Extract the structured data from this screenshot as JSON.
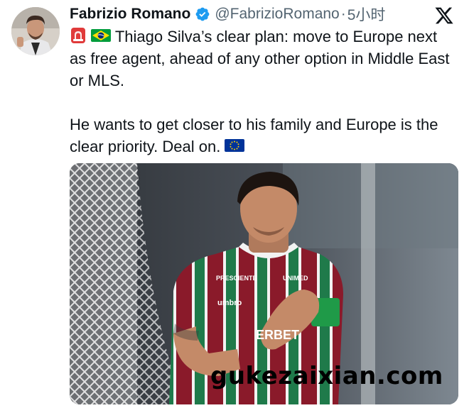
{
  "author": {
    "name": "Fabrizio Romano",
    "handle": "@FabrizioRomano",
    "separator": "·",
    "time": "5小时"
  },
  "tweet": {
    "paragraph1": "Thiago Silva’s clear plan: move to Europe next as free agent, ahead of any other option in Middle East or MLS.",
    "paragraph2_text": "He wants to get closer to his family and Europe is the clear priority. Deal on.",
    "leading_icons": [
      "siren-emoji",
      "brazil-flag-emoji"
    ],
    "trailing_icon": "eu-flag-emoji"
  },
  "photo": {
    "jersey_texts": [
      "PRESCIENTE",
      "umbro",
      "UNIMED",
      "ERBET"
    ]
  },
  "watermark": "gukezaixian.com",
  "colors": {
    "text": "#0f1419",
    "secondary": "#536471",
    "verified": "#1d9bf0",
    "jersey_green": "#1f7a4a",
    "jersey_maroon": "#8a1a2a"
  }
}
